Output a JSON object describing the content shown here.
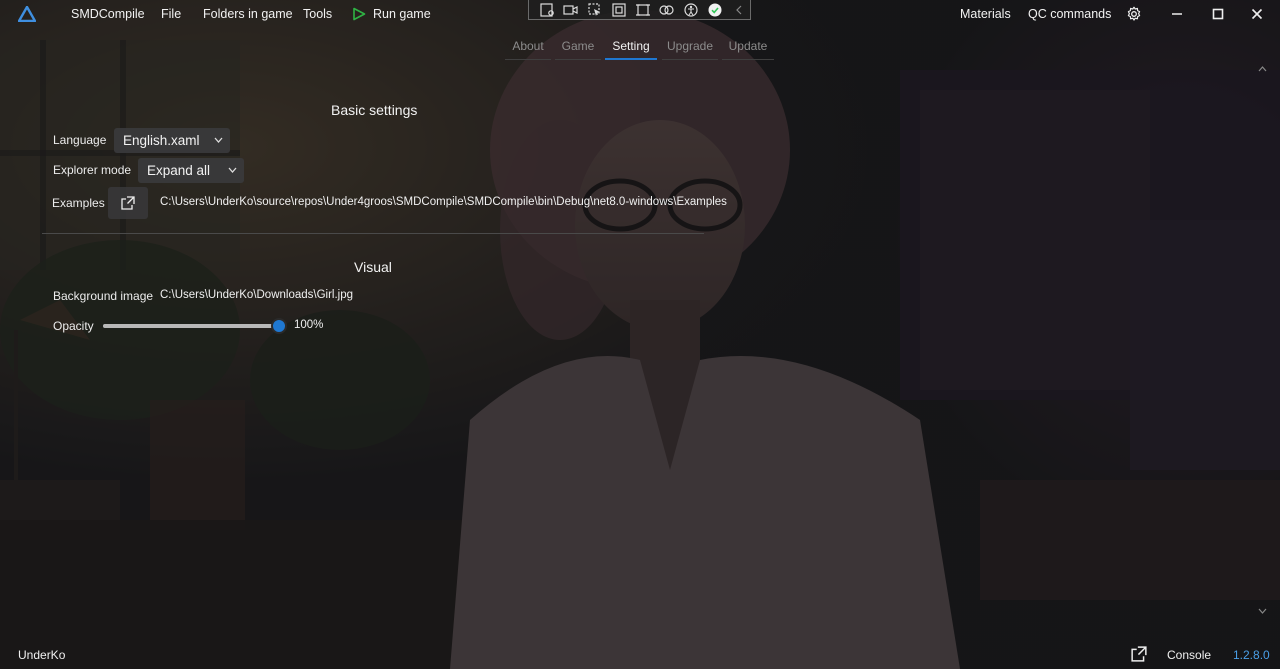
{
  "app": {
    "title": "SMDCompile",
    "background_image_subject": "girl-portrait"
  },
  "menu": {
    "file": "File",
    "folders": "Folders in game",
    "tools": "Tools",
    "run": "Run game",
    "materials": "Materials",
    "qc_commands": "QC commands"
  },
  "tabs": [
    {
      "label": "About",
      "active": false
    },
    {
      "label": "Game",
      "active": false
    },
    {
      "label": "Setting",
      "active": true
    },
    {
      "label": "Upgrade",
      "active": false
    },
    {
      "label": "Update",
      "active": false
    }
  ],
  "basic": {
    "title": "Basic settings",
    "language_label": "Language",
    "language_value": "English.xaml",
    "explorer_label": "Explorer mode",
    "explorer_value": "Expand all",
    "examples_label": "Examples",
    "examples_path": "C:\\Users\\UnderKo\\source\\repos\\Under4groos\\SMDCompile\\SMDCompile\\bin\\Debug\\net8.0-windows\\Examples"
  },
  "visual": {
    "title": "Visual",
    "background_label": "Background image",
    "background_path": "C:\\Users\\UnderKo\\Downloads\\Girl.jpg",
    "opacity_label": "Opacity",
    "opacity_value": 1.0,
    "opacity_text": "100%"
  },
  "status": {
    "user": "UnderKo",
    "console": "Console",
    "version": "1.2.8.0"
  },
  "colors": {
    "accent": "#1f78d1",
    "run_icon": "#2fb344",
    "version": "#4a9fe8",
    "devtool_check": "#34c759"
  },
  "icons": {
    "logo": "app-logo-icon",
    "run": "play-icon",
    "settings": "gear-icon",
    "examples_open": "open-external-icon",
    "console_open": "open-external-icon"
  }
}
